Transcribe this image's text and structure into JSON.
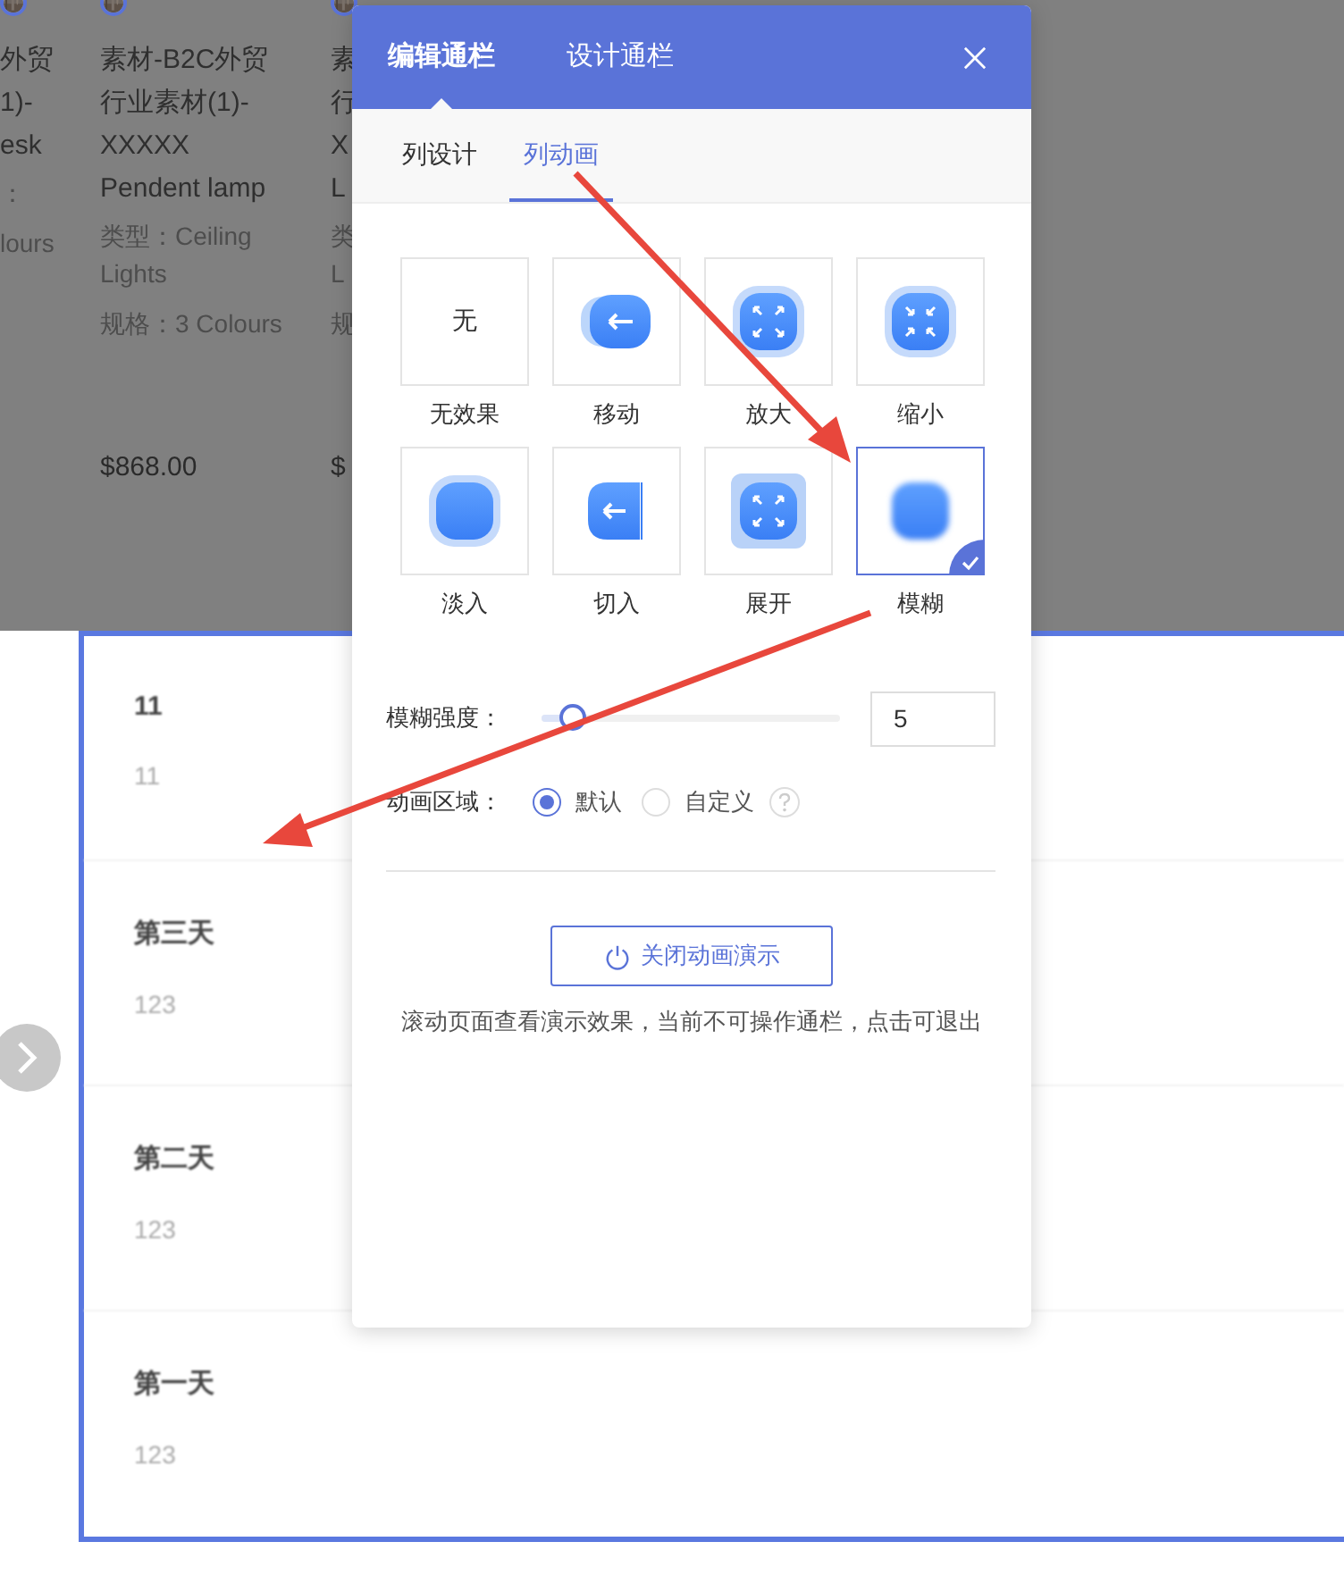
{
  "background_page": {
    "products": [
      {
        "title_lines": [
          "外贸",
          "1)-",
          "esk"
        ],
        "type_lines": [
          "："
        ],
        "spec": "lours"
      },
      {
        "title_lines": [
          "素材-B2C外贸",
          "行业素材(1)-",
          "XXXXX",
          "Pendent lamp"
        ],
        "type_lines": [
          "类型：Ceiling",
          "Lights"
        ],
        "spec": "规格：3 Colours",
        "price": "$868.00"
      },
      {
        "title_lines": [
          "素",
          "行",
          "X",
          "L"
        ],
        "type_lines": [
          "类",
          "L"
        ],
        "spec": "规",
        "price": "$"
      }
    ],
    "list_items": [
      {
        "title": "11",
        "subtitle": "11"
      },
      {
        "title": "第三天",
        "subtitle": "123"
      },
      {
        "title": "第二天",
        "subtitle": "123"
      },
      {
        "title": "第一天",
        "subtitle": "123"
      }
    ]
  },
  "modal": {
    "header_tabs": [
      {
        "label": "编辑通栏",
        "selected": true
      },
      {
        "label": "设计通栏",
        "selected": false
      }
    ],
    "sub_tabs": [
      {
        "label": "列设计",
        "selected": false
      },
      {
        "label": "列动画",
        "selected": true
      }
    ],
    "effects": [
      {
        "kind": "none",
        "icon_text": "无",
        "label": "无效果",
        "selected": false
      },
      {
        "kind": "move",
        "label": "移动",
        "selected": false
      },
      {
        "kind": "zoom-in",
        "label": "放大",
        "selected": false
      },
      {
        "kind": "zoom-out",
        "label": "缩小",
        "selected": false
      },
      {
        "kind": "fade",
        "label": "淡入",
        "selected": false
      },
      {
        "kind": "cut",
        "label": "切入",
        "selected": false
      },
      {
        "kind": "expand",
        "label": "展开",
        "selected": false
      },
      {
        "kind": "blur",
        "label": "模糊",
        "selected": true
      }
    ],
    "blur_strength": {
      "label": "模糊强度：",
      "level": 0.1,
      "value": "5"
    },
    "area": {
      "label": "动画区域：",
      "options": [
        {
          "label": "默认",
          "selected": true
        },
        {
          "label": "自定义",
          "selected": false
        }
      ]
    },
    "button": "关闭动画演示",
    "note": "滚动页面查看演示效果，当前不可操作通栏，点击可退出"
  }
}
